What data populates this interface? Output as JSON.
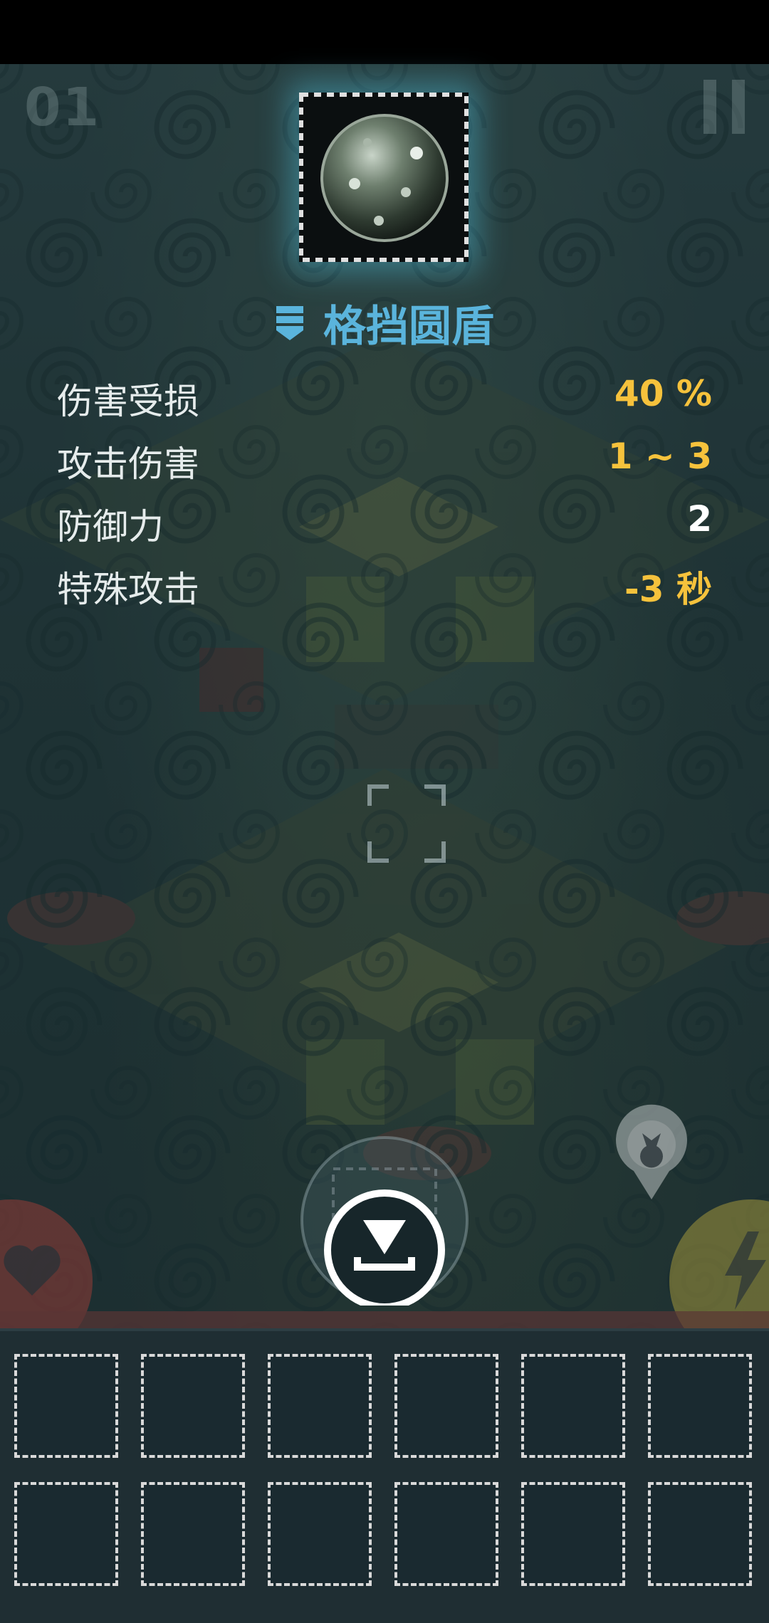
{
  "hud": {
    "wave_counter": "01",
    "pause_icon": "pause-icon"
  },
  "item": {
    "icon": "block-shield-orb-icon",
    "type_icon": "shield-icon",
    "name": "格挡圆盾",
    "name_color": "#5ab4dc"
  },
  "stats": [
    {
      "label": "伤害受损",
      "value": "40 %",
      "value_color": "#f6c23c"
    },
    {
      "label": "攻击伤害",
      "value": "1 ~ 3",
      "value_color": "#f6c23c"
    },
    {
      "label": "防御力",
      "value": "2",
      "value_color": "#ffffff"
    },
    {
      "label": "特殊攻击",
      "value": "-3 秒",
      "value_color": "#f6c23c"
    }
  ],
  "controls": {
    "collect_icon": "download-arrow-icon",
    "left_button_icon": "heart-icon",
    "right_button_icon": "lightning-icon",
    "loot_icon": "loot-bag-icon",
    "reticle_icon": "target-reticle-icon"
  },
  "inventory": {
    "rows": 2,
    "columns": 6,
    "slots": [
      "",
      "",
      "",
      "",
      "",
      "",
      "",
      "",
      "",
      "",
      "",
      ""
    ]
  }
}
